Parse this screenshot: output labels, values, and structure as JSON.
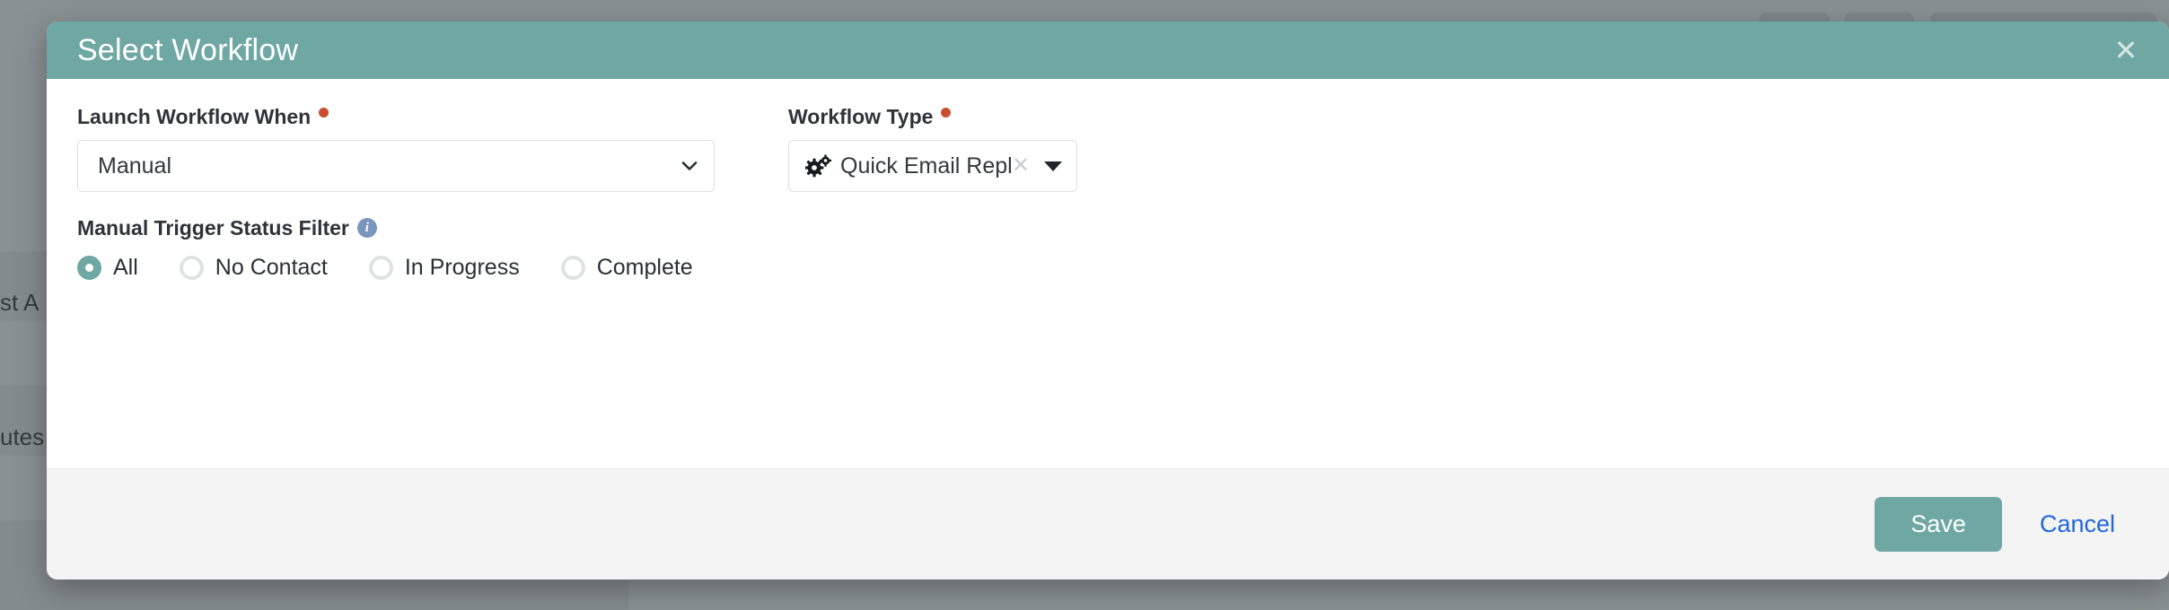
{
  "background": {
    "text_fragments": [
      {
        "text": "st A"
      },
      {
        "text": "utes"
      }
    ],
    "toolbar_buttons": [
      "",
      "",
      ""
    ]
  },
  "modal": {
    "title": "Select Workflow",
    "close_icon": "close-icon",
    "fields": {
      "launch_when": {
        "label": "Launch Workflow When",
        "required": true,
        "value": "Manual",
        "chevron_icon": "chevron-down-icon"
      },
      "workflow_type": {
        "label": "Workflow Type",
        "required": true,
        "value": "Quick Email Reply",
        "prefix_icon": "cogs-icon",
        "clear_icon": "clear-x-icon",
        "caret_icon": "caret-down-icon"
      },
      "status_filter": {
        "label": "Manual Trigger Status Filter",
        "info_icon": "info-icon",
        "info_glyph": "i",
        "selected": "All",
        "options": [
          {
            "label": "All",
            "checked": true
          },
          {
            "label": "No Contact",
            "checked": false
          },
          {
            "label": "In Progress",
            "checked": false
          },
          {
            "label": "Complete",
            "checked": false
          }
        ]
      }
    },
    "footer": {
      "save_label": "Save",
      "cancel_label": "Cancel"
    }
  },
  "colors": {
    "accent_teal": "#6fa7a3",
    "required_red": "#c94f30",
    "link_blue": "#2266dd",
    "info_blue": "#7b95bd"
  }
}
